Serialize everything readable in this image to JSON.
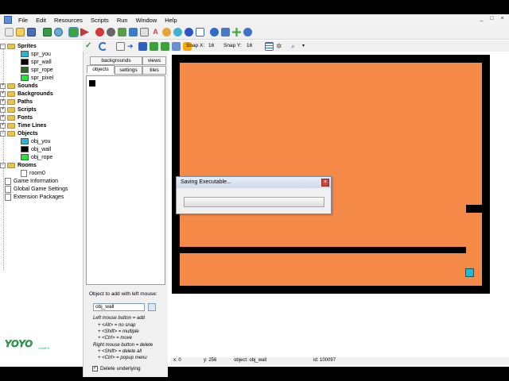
{
  "menu": [
    "File",
    "Edit",
    "Resources",
    "Scripts",
    "Run",
    "Window",
    "Help"
  ],
  "window_controls": [
    "_",
    "□",
    "×"
  ],
  "resource_tree": [
    {
      "label": "Sprites",
      "type": "folder",
      "expanded": true,
      "bold": true
    },
    {
      "label": "spr_you",
      "type": "sprite",
      "color": "#23b7d8"
    },
    {
      "label": "spr_wall",
      "type": "sprite",
      "color": "#000000"
    },
    {
      "label": "spr_rope",
      "type": "sprite",
      "color": "#2a6b2a"
    },
    {
      "label": "spr_pixel",
      "type": "sprite",
      "color": "#1ee83a"
    },
    {
      "label": "Sounds",
      "type": "folder",
      "bold": true
    },
    {
      "label": "Backgrounds",
      "type": "folder",
      "bold": true
    },
    {
      "label": "Paths",
      "type": "folder",
      "bold": true
    },
    {
      "label": "Scripts",
      "type": "folder",
      "bold": true
    },
    {
      "label": "Fonts",
      "type": "folder",
      "bold": true
    },
    {
      "label": "Time Lines",
      "type": "folder",
      "bold": true
    },
    {
      "label": "Objects",
      "type": "folder",
      "expanded": true,
      "bold": true
    },
    {
      "label": "obj_you",
      "type": "object",
      "color": "#23b7d8"
    },
    {
      "label": "obj_wall",
      "type": "object",
      "color": "#000000"
    },
    {
      "label": "obj_rope",
      "type": "object",
      "color": "#1ee83a"
    },
    {
      "label": "Rooms",
      "type": "folder",
      "expanded": true,
      "bold": true
    },
    {
      "label": "room0",
      "type": "room"
    },
    {
      "label": "Game Information",
      "type": "doc"
    },
    {
      "label": "Global Game Settings",
      "type": "doc"
    },
    {
      "label": "Extension Packages",
      "type": "doc"
    }
  ],
  "room_toolbar": {
    "snap_x_label": "Snap X:",
    "snap_x_value": "16",
    "snap_y_label": "Snap Y:",
    "snap_y_value": "16"
  },
  "tabs": {
    "row1": [
      "backgrounds",
      "views"
    ],
    "row2": [
      "objects",
      "settings",
      "tiles"
    ],
    "active": "objects"
  },
  "object_help": {
    "title": "Object to add with left mouse:",
    "field_value": "obj_wall",
    "lines": [
      "Left mouse button = add",
      "+ <Alt> = no snap",
      "+ <Shift> = multiple",
      "+ <Ctrl> = move",
      "Right mouse button = delete",
      "+ <Shift> = delete all",
      "+ <Ctrl> = popup menu"
    ],
    "checkbox_checked": true,
    "checkbox_label": "Delete underlying"
  },
  "status": {
    "x": "x: 0",
    "y": "y: 256",
    "object": "object: obj_wall",
    "id": "id: 100097"
  },
  "dialog": {
    "title": "Saving Executable...",
    "close": "×",
    "progress": 0.0
  },
  "logo": "YOYO GAMES",
  "colors": {
    "room_floor": "#f58a48",
    "wall": "#000000",
    "player": "#23b7d8"
  }
}
